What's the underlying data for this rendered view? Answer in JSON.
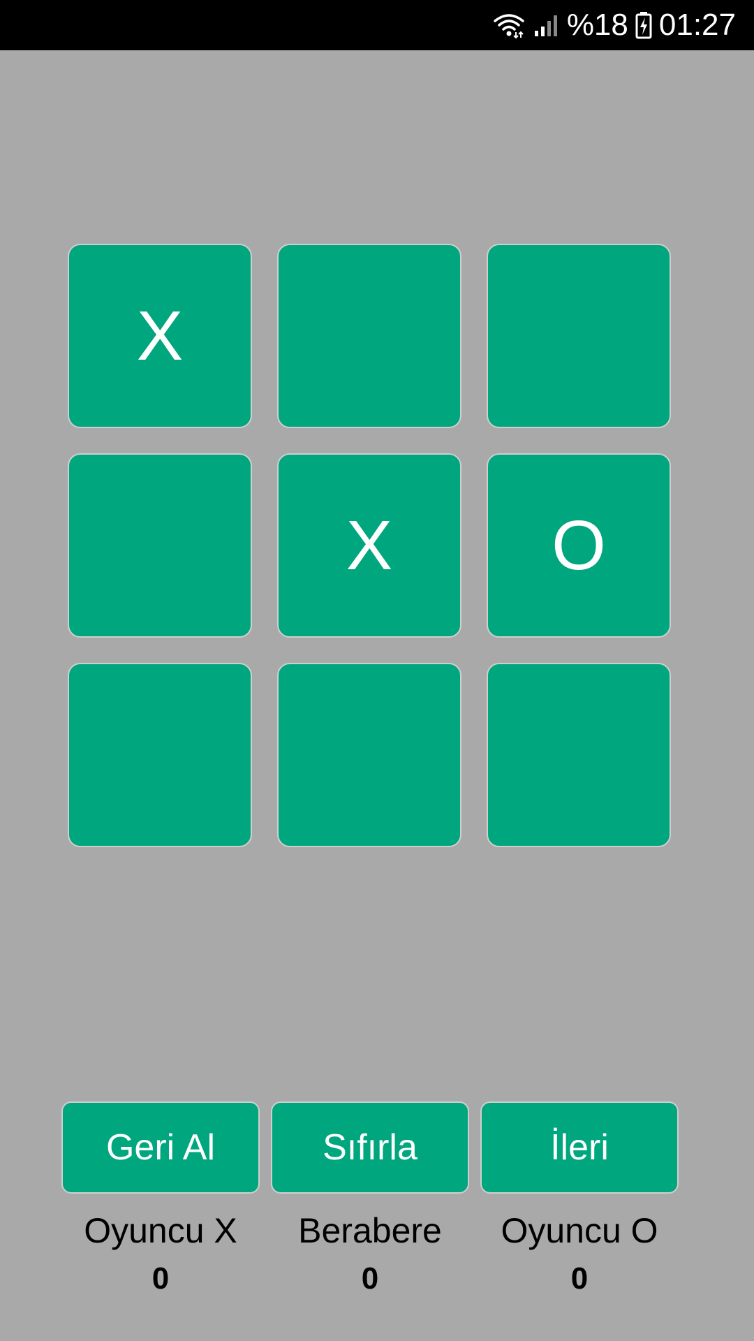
{
  "status_bar": {
    "battery_percent": "%18",
    "time": "01:27",
    "icons": [
      "wifi-icon",
      "signal-icon",
      "battery-charging-icon"
    ]
  },
  "board": {
    "cells": [
      "X",
      "",
      "",
      "",
      "X",
      "O",
      "",
      "",
      ""
    ]
  },
  "controls": {
    "back_label": "Geri Al",
    "reset_label": "Sıfırla",
    "next_label": "İleri"
  },
  "scores": {
    "x_label": "Oyuncu X",
    "x_value": "0",
    "draw_label": "Berabere",
    "draw_value": "0",
    "o_label": "Oyuncu O",
    "o_value": "0"
  },
  "colors": {
    "background": "#a9a9a9",
    "cell": "#00a67d",
    "status_bar": "#000000",
    "text_light": "#ffffff",
    "text_dark": "#000000"
  }
}
